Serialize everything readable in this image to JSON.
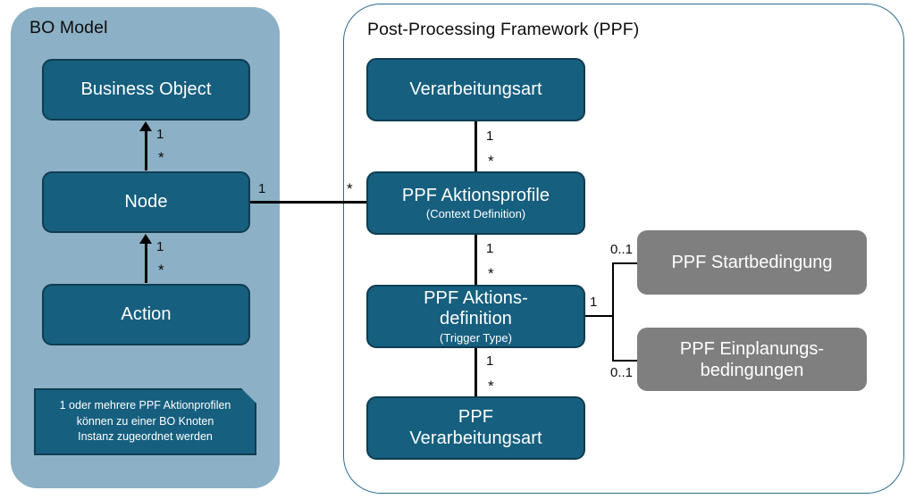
{
  "diagram": {
    "title_bo": "BO Model",
    "title_ppf": "Post-Processing Framework (PPF)"
  },
  "bo_model": {
    "boxes": [
      {
        "id": "business-object",
        "label": "Business Object"
      },
      {
        "id": "node",
        "label": "Node"
      },
      {
        "id": "action",
        "label": "Action"
      }
    ],
    "note": {
      "line1": "1 oder mehrere PPF Aktionprofilen",
      "line2": "können zu einer BO Knoten",
      "line3": "Instanz zugeordnet werden"
    },
    "multiplicities": {
      "bo_node_top": "1",
      "bo_node_bottom": "*",
      "node_action_top": "1",
      "node_action_bottom": "*",
      "node_right": "1"
    }
  },
  "ppf": {
    "boxes": [
      {
        "id": "verarbeitungsart",
        "label": "Verarbeitungsart",
        "sub": ""
      },
      {
        "id": "ppf-aktionsprofile",
        "label": "PPF Aktionsprofile",
        "sub": "(Context Definition)"
      },
      {
        "id": "ppf-aktionsdefinition",
        "label_line1": "PPF Aktions-",
        "label_line2": "definition",
        "sub": "(Trigger Type)"
      },
      {
        "id": "ppf-verarbeitungsart",
        "label_line1": "PPF",
        "label_line2": "Verarbeitungsart",
        "sub": ""
      }
    ],
    "conditions": [
      {
        "id": "ppf-startbedingung",
        "label": "PPF Startbedingung"
      },
      {
        "id": "ppf-einplanungsbedingungen",
        "label_line1": "PPF Einplanungs-",
        "label_line2": "bedingungen"
      }
    ],
    "multiplicities": {
      "verarbeitungsart_profile_top": "1",
      "verarbeitungsart_profile_bottom": "*",
      "profile_left": "*",
      "profile_definition_top": "1",
      "profile_definition_bottom": "*",
      "definition_right": "1",
      "definition_verarbeitungsart_top": "1",
      "definition_verarbeitungsart_bottom": "*",
      "startbedingung": "0..1",
      "einplanungsbedingungen": "0..1"
    }
  },
  "colors": {
    "box_fill": "#165f7f",
    "box_border": "#0f3d52",
    "gray_fill": "#7f7f7f",
    "bo_container_fill": "#8cb0c5",
    "ppf_container_border": "#2b6c8f",
    "connector": "#000000",
    "text_on_box": "#ffffff",
    "text_dark": "#0d0d0d"
  }
}
